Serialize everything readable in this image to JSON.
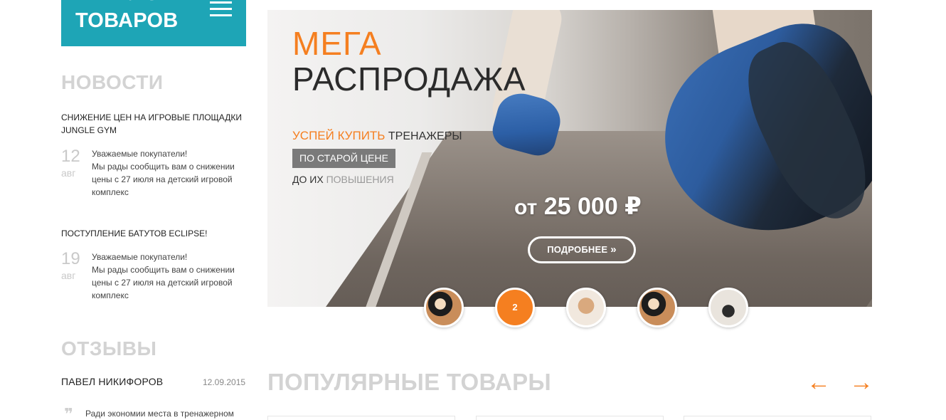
{
  "catalog": {
    "title": "КАТАЛОГ\nТОВАРОВ",
    "menu_icon": "hamburger-icon"
  },
  "news": {
    "heading": "НОВОСТИ",
    "items": [
      {
        "title": "СНИЖЕНИЕ ЦЕН НА ИГРОВЫЕ ПЛОЩАДКИ JUNGLE GYM",
        "day": "12",
        "month": "авг",
        "text": "Уважаемые покупатели!\nМы рады сообщить вам о снижении цены с 27 июля на детский игровой комплекс"
      },
      {
        "title": "ПОСТУПЛЕНИЕ БАТУТОВ ECLIPSE!",
        "day": "19",
        "month": "авг",
        "text": "Уважаемые покупатели!\nМы рады сообщить вам о снижении цены с 27 июля на детский игровой комплекс"
      }
    ]
  },
  "reviews": {
    "heading": "ОТЗЫВЫ",
    "name": "ПАВЕЛ НИКИФОРОВ",
    "date": "12.09.2015",
    "text": "Ради экономии места в тренажерном",
    "quote_icon": "quote-icon"
  },
  "banner": {
    "mega": "МЕГА",
    "sale": "РАСПРОДАЖА",
    "hurry": "УСПЕЙ КУПИТЬ",
    "trainers": "ТРЕНАЖЕРЫ",
    "old_price": "ПО СТАРОЙ ЦЕНЕ",
    "before": "ДО ИХ",
    "increase": "ПОВЫШЕНИЯ",
    "price_from": "от",
    "price": "25 000 ₽",
    "more_label": "ПОДРОБНЕЕ",
    "more_icon": "double-chevron-right-icon",
    "accent_color": "#f57f20"
  },
  "slider": {
    "active_label": "2",
    "count": 5,
    "active_index": 2
  },
  "popular": {
    "heading": "ПОПУЛЯРНЫЕ ТОВАРЫ",
    "prev_icon": "arrow-left-icon",
    "next_icon": "arrow-right-icon"
  }
}
